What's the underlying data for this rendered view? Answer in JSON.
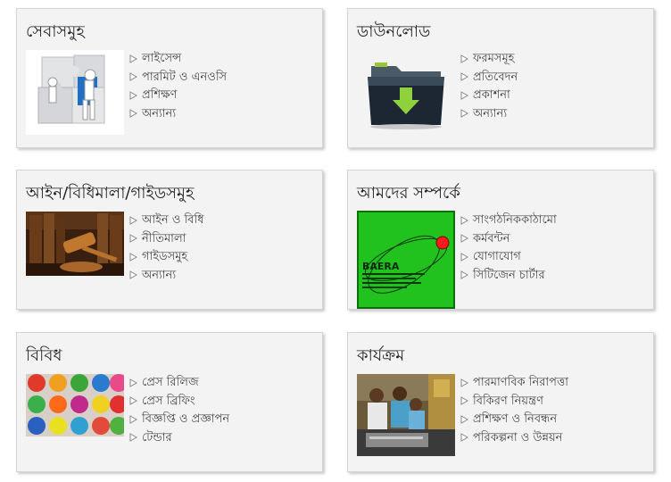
{
  "cards": [
    {
      "title": "সেবাসমুহ",
      "image": "puzzle-people-image",
      "links": [
        "লাইসেন্স",
        "পারমিট ও এনওসি",
        "প্রশিক্ষণ",
        "অন্যান্য"
      ]
    },
    {
      "title": "ডাউনলোড",
      "image": "download-folder-image",
      "links": [
        "ফরমসমূহ",
        "প্রতিবেদন",
        "প্রকাশনা",
        "অন্যান্য"
      ]
    },
    {
      "title": "আইন/বিধিমালা/গাইডসমুহ",
      "image": "gavel-books-image",
      "links": [
        "আইন ও বিধি",
        "নীতিমালা",
        "গাইডসমুহ",
        "অন্যান্য"
      ]
    },
    {
      "title": "আমদের সম্পর্কে",
      "image": "baera-logo-image",
      "logo_text": "BAERA",
      "links": [
        "সাংগঠনিককাঠামো",
        "কর্মবন্টন",
        "যোগাযোগ",
        "সিটিজেন চার্টার"
      ]
    },
    {
      "title": "বিবিধ",
      "image": "colorful-jars-image",
      "links": [
        "প্রেস রিলিজ",
        "প্রেস ব্রিফিং",
        "বিজ্ঞপ্তি ও প্রজ্ঞাপন",
        "টেন্ডার"
      ]
    },
    {
      "title": "কার্যক্রম",
      "image": "workers-lab-image",
      "links": [
        "পারমাণবিক নিরাপত্তা",
        "বিকিরণ নিয়ন্ত্রণ",
        "প্রশিক্ষণ ও নিবন্ধন",
        "পরিকল্পনা ও উন্নয়ন"
      ]
    }
  ]
}
